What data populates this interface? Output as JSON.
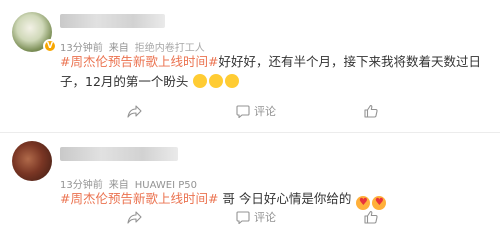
{
  "posts": [
    {
      "time": "13分钟前",
      "source": "来自",
      "device": "拒绝内卷打工人",
      "topic": "#周杰伦预告新歌上线时间#",
      "text": "好好好，还有半个月，接下来我将数着天数过日子，12月的第一个盼头",
      "emoji": "😭",
      "actions": {
        "share": "",
        "comment": "评论",
        "like": ""
      }
    },
    {
      "time": "13分钟前",
      "source": "来自",
      "device": "HUAWEI P50",
      "topic": "#周杰伦预告新歌上线时间#",
      "text": " 哥 今日好心情是你给的",
      "emoji": "😍",
      "actions": {
        "share": "",
        "comment": "评论",
        "like": ""
      }
    }
  ],
  "colors": {
    "topic": "#eb7350",
    "meta": "#939393",
    "text": "#333333"
  }
}
